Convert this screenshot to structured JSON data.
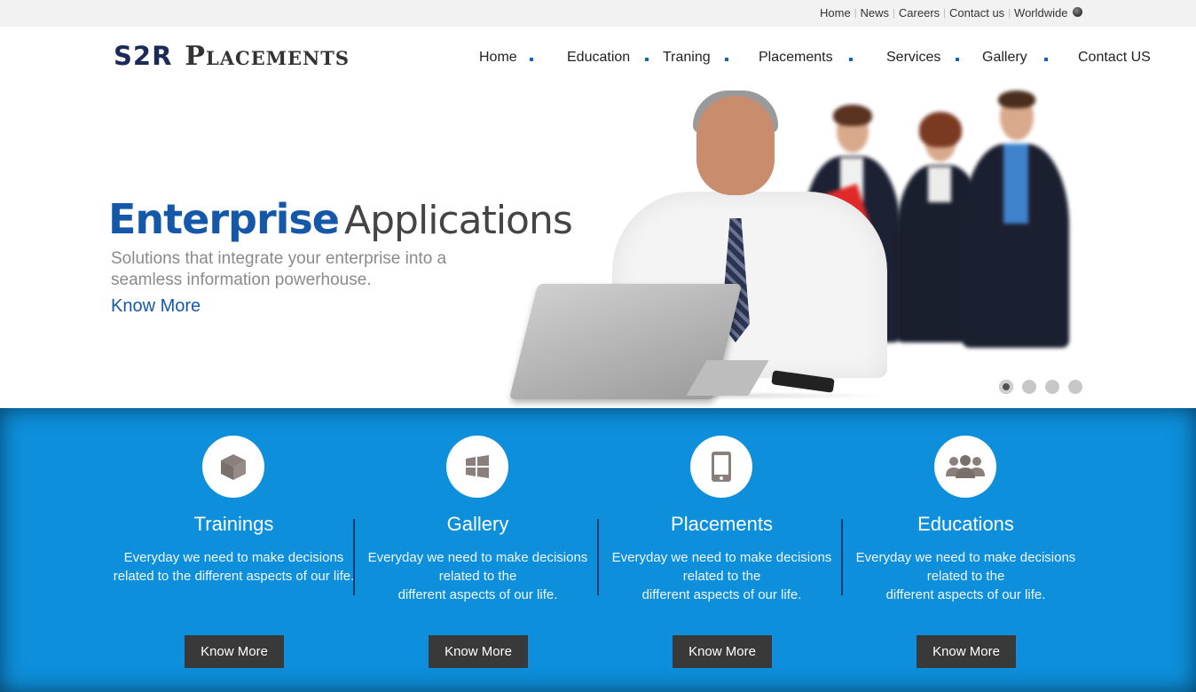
{
  "topbar": {
    "links": [
      "Home",
      "News",
      "Careers",
      "Contact us",
      "Worldwide"
    ],
    "globe_icon": "globe-icon"
  },
  "header": {
    "logo_part1": "S2R",
    "logo_part2": "Placements",
    "nav": [
      "Home",
      "Education",
      "Traning",
      "Placements",
      "Services",
      "Gallery",
      "Contact US"
    ]
  },
  "hero": {
    "title_bold": "Enterprise",
    "title_light": "Applications",
    "subtitle": "Solutions that integrate your enterprise into a seamless information powerhouse.",
    "link": "Know More",
    "slides": 4,
    "active_slide": 1
  },
  "features": [
    {
      "title": "Trainings",
      "text": "Everyday we need to make decisions related to the different aspects of our life.",
      "button": "Know More",
      "icon": "box-icon"
    },
    {
      "title": "Gallery",
      "text": "Everyday we need to make decisions related to the\ndifferent aspects of our life.",
      "button": "Know More",
      "icon": "windows-icon"
    },
    {
      "title": "Placements",
      "text": "Everyday we need to make decisions related to the\ndifferent aspects of our life.",
      "button": "Know More",
      "icon": "mobile-phone-icon"
    },
    {
      "title": "Educations",
      "text": "Everyday we need to make decisions related to the\ndifferent aspects of our life.",
      "button": "Know More",
      "icon": "group-users-icon"
    }
  ],
  "colors": {
    "brand_navy": "#1b2b57",
    "accent_blue": "#1557a8",
    "band_blue": "#0d8fdb",
    "button_dark": "#393939"
  }
}
